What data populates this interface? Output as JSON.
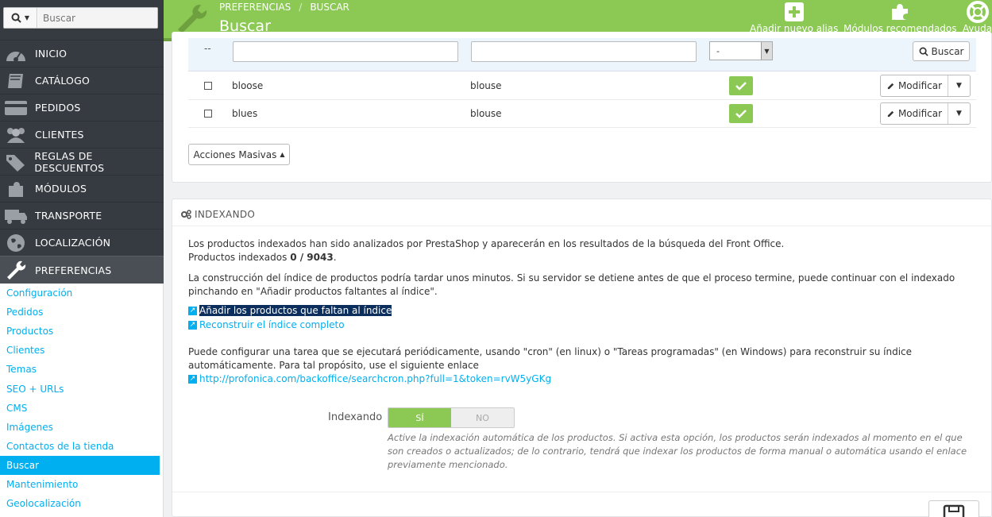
{
  "search": {
    "placeholder": "Buscar"
  },
  "sidebar": {
    "items": [
      {
        "label": "INICIO",
        "icon": "dashboard-icon"
      },
      {
        "label": "CATÁLOGO",
        "icon": "book-icon"
      },
      {
        "label": "PEDIDOS",
        "icon": "credit-card-icon"
      },
      {
        "label": "CLIENTES",
        "icon": "users-icon"
      },
      {
        "label": "REGLAS DE DESCUENTOS",
        "icon": "tags-icon"
      },
      {
        "label": "MÓDULOS",
        "icon": "puzzle-icon"
      },
      {
        "label": "TRANSPORTE",
        "icon": "truck-icon"
      },
      {
        "label": "LOCALIZACIÓN",
        "icon": "globe-icon"
      },
      {
        "label": "PREFERENCIAS",
        "icon": "wrench-icon"
      }
    ],
    "submenu": [
      "Configuración",
      "Pedidos",
      "Productos",
      "Clientes",
      "Temas",
      "SEO + URLs",
      "CMS",
      "Imágenes",
      "Contactos de la tienda",
      "Buscar",
      "Mantenimiento",
      "Geolocalización"
    ]
  },
  "header": {
    "breadcrumb_1": "PREFERENCIAS",
    "breadcrumb_sep": "/",
    "breadcrumb_2": "BUSCAR",
    "title": "Buscar",
    "add_alias": "Añadir nuevo alias",
    "modules": "Módulos recomendados",
    "help": "Ayuda"
  },
  "list": {
    "filter_dots": "--",
    "select_value": "-",
    "search_button": "Buscar",
    "rows": [
      {
        "alias": "bloose",
        "search": "blouse",
        "edit": "Modificar"
      },
      {
        "alias": "blues",
        "search": "blouse",
        "edit": "Modificar"
      }
    ],
    "bulk_actions": "Acciones Masivas"
  },
  "indexing": {
    "heading": "INDEXANDO",
    "p1_line1": "Los productos indexados han sido analizados por PrestaShop y aparecerán en los resultados de la búsqueda del Front Office.",
    "p1_line2_prefix": "Productos indexados ",
    "p1_count": "0 / 9043",
    "p1_line2_suffix": ".",
    "p2": "La construcción del índice de productos podría tardar unos minutos. Si su servidor se detiene antes de que el proceso termine, puede continuar con el indexado pinchando en \"Añadir productos faltantes al índice\".",
    "link_add": "Añadir los productos que faltan al índice",
    "link_rebuild": "Reconstruir el índice completo",
    "p3": "Puede configurar una tarea que se ejecutará periódicamente, usando \"cron\" (en linux) o \"Tareas programadas\" (en Windows) para reconstruir su índice automáticamente. Para tal propósito, use el siguiente enlace",
    "cron_link": "http://profonica.com/backoffice/searchcron.php?full=1&token=rvW5yGKg",
    "toggle_label": "Indexando",
    "toggle_on": "SÍ",
    "toggle_off": "NO",
    "toggle_state": "on",
    "help_text": "Active la indexación automática de los productos. Si activa esta opción, los productos serán indexados al momento en el que son creados o actualizados; de lo contrario, tendrá que indexar los productos de forma manual o automática usando el enlace previamente mencionado."
  },
  "colors": {
    "header_green": "#8bc954",
    "sidebar_dark": "#363a41",
    "link_blue": "#00aff0"
  }
}
